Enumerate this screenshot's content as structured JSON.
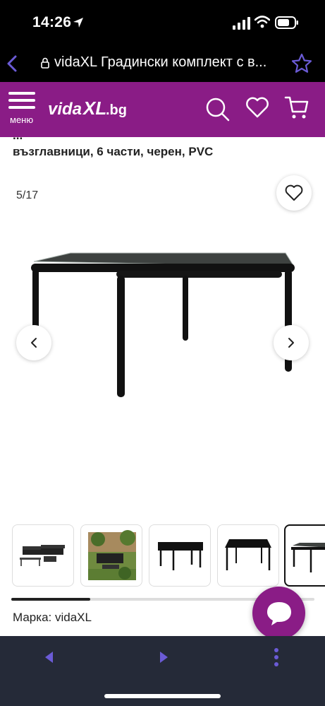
{
  "status_bar": {
    "time": "14:26"
  },
  "browser": {
    "url_title": "vidaXL Градински комплект с в..."
  },
  "header": {
    "menu_label": "меню",
    "logo_text": "vidaXL.bg"
  },
  "product": {
    "title_partial": "...",
    "title": "възглавници, 6 части, черен, PVC",
    "image_counter": "5/17",
    "brand_line": "Марка: vidaXL"
  },
  "gallery": {
    "thumbnails": [
      {
        "name": "set-overview"
      },
      {
        "name": "garden-photo"
      },
      {
        "name": "table-side"
      },
      {
        "name": "table-angle"
      },
      {
        "name": "table-glass"
      }
    ],
    "scroll_progress": 0.26
  },
  "colors": {
    "brand": "#8a1c86",
    "browser_accent": "#6b5bd6",
    "bottom_bar": "#252a38"
  }
}
